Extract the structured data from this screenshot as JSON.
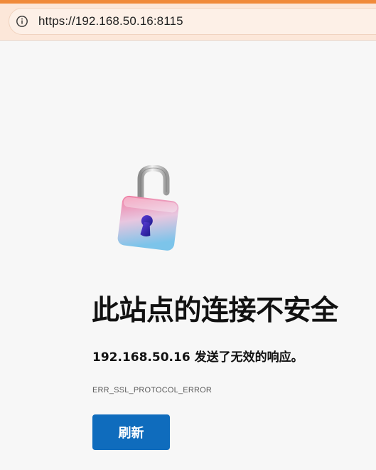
{
  "browser": {
    "url": "https://192.168.50.16:8115",
    "info_icon": "info-circle-icon",
    "accent_color": "#f08a3a"
  },
  "error": {
    "icon": "unlocked-padlock-icon",
    "title": "此站点的连接不安全",
    "message": "192.168.50.16 发送了无效的响应。",
    "code": "ERR_SSL_PROTOCOL_ERROR",
    "reload_label": "刷新",
    "button_color": "#0f6cbd"
  }
}
